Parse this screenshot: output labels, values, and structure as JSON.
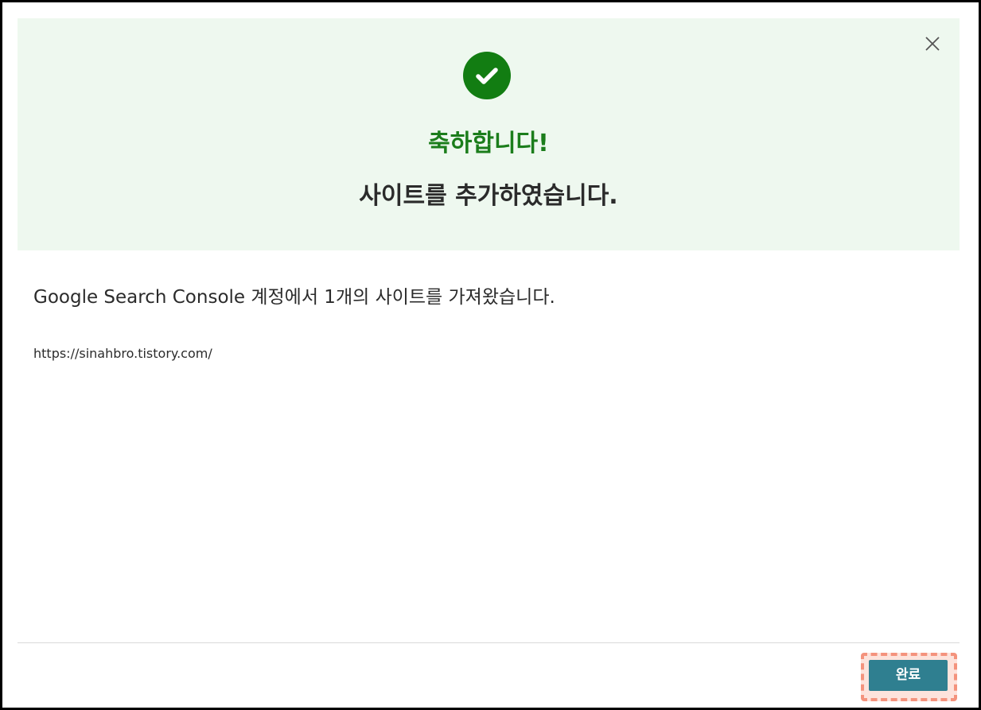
{
  "dialog": {
    "close_icon": "close-icon",
    "success_icon": "check-circle-icon",
    "congrats_title": "축하합니다!",
    "added_heading": "사이트를 추가하였습니다.",
    "message": "Google Search Console 계정에서 1개의 사이트를 가져왔습니다.",
    "sites": [
      "https://sinahbro.tistory.com/"
    ],
    "done_label": "완료"
  },
  "colors": {
    "banner_bg": "#eef8ef",
    "success_green": "#127d12",
    "title_green": "#1b7d1b",
    "button_teal": "#2f7f90",
    "highlight_dashed": "#f4937d"
  }
}
